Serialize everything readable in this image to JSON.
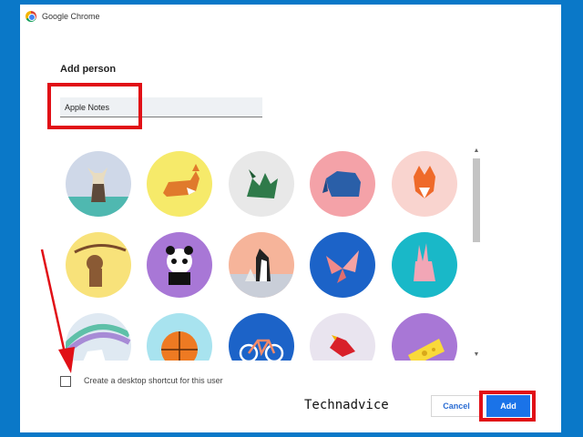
{
  "window": {
    "title": "Google Chrome"
  },
  "dialog": {
    "heading": "Add person",
    "name_value": "Apple Notes",
    "shortcut_label": "Create a desktop shortcut for this user",
    "shortcut_checked": false,
    "cancel_label": "Cancel",
    "add_label": "Add"
  },
  "avatars": [
    "cat-icon",
    "corgi-icon",
    "dragon-icon",
    "elephant-icon",
    "fox-icon",
    "monkey-icon",
    "panda-icon",
    "penguin-icon",
    "butterfly-icon",
    "rabbit-icon",
    "unicorn-icon",
    "basketball-icon",
    "bicycle-icon",
    "bird-icon",
    "cheese-icon"
  ],
  "watermark": "Technadvice",
  "colors": {
    "accent": "#1a73e8",
    "highlight": "#e10f16",
    "background": "#0a78c8"
  }
}
